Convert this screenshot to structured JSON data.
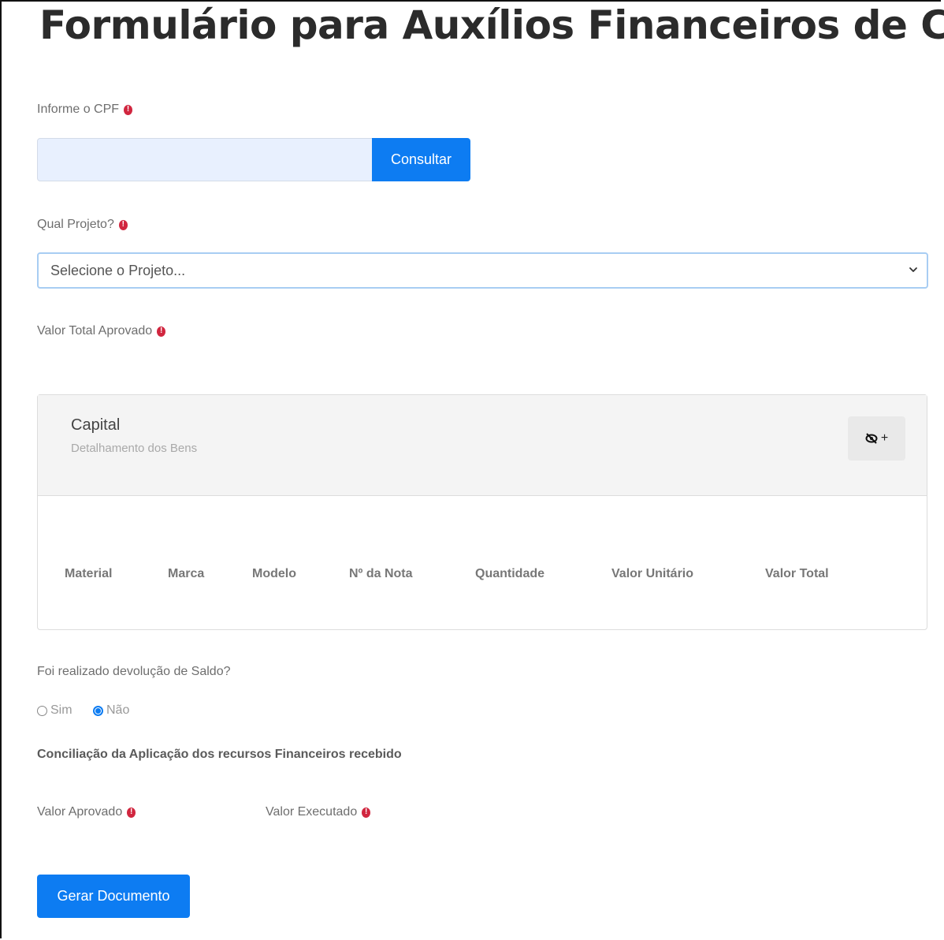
{
  "page": {
    "title": "Formulário para Auxílios Financeiros de CTI"
  },
  "cpf": {
    "label": "Informe o CPF",
    "value": "",
    "button": "Consultar"
  },
  "projeto": {
    "label": "Qual Projeto?",
    "selected": "Selecione o Projeto..."
  },
  "valor_total": {
    "label": "Valor Total Aprovado"
  },
  "capital": {
    "title": "Capital",
    "subtitle": "Detalhamento dos Bens",
    "toggle_icons": [
      "eye-slash-icon",
      "plus-icon"
    ],
    "columns": [
      "Material",
      "Marca",
      "Modelo",
      "Nº da Nota",
      "Quantidade",
      "Valor Unitário",
      "Valor Total"
    ]
  },
  "devolucao": {
    "question": "Foi realizado devolução de Saldo?",
    "options": [
      "Sim",
      "Não"
    ],
    "selected": "Não"
  },
  "conciliacao": {
    "title": "Conciliação da Aplicação dos recursos Financeiros recebido",
    "valor_aprovado": "Valor Aprovado",
    "valor_executado": "Valor Executado"
  },
  "actions": {
    "generate": "Gerar Documento"
  },
  "colors": {
    "primary": "#0d7cf2",
    "required": "#d1263f",
    "input_fill": "#e8f0fe"
  }
}
